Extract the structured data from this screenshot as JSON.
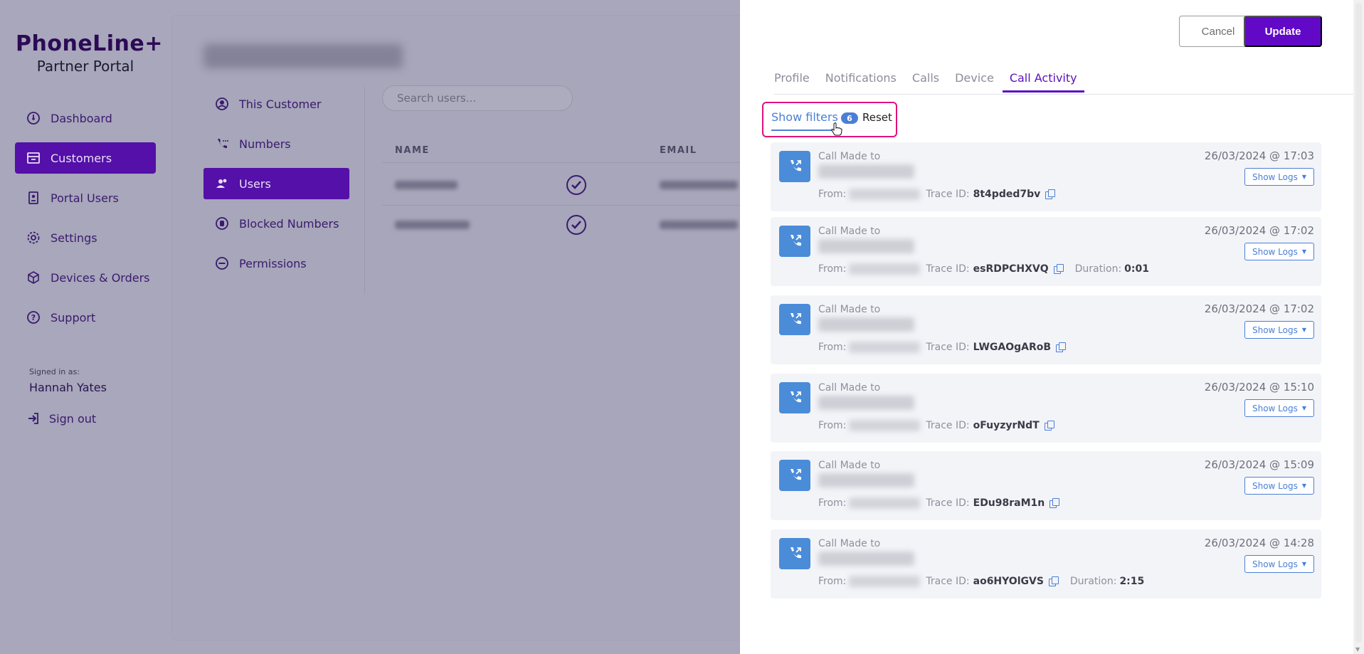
{
  "brand": {
    "name": "PhoneLine+",
    "subtitle": "Partner Portal"
  },
  "sidebar": {
    "items": [
      {
        "label": "Dashboard",
        "icon": "dashboard-icon"
      },
      {
        "label": "Customers",
        "icon": "store-icon",
        "active": true
      },
      {
        "label": "Portal Users",
        "icon": "badge-icon"
      },
      {
        "label": "Settings",
        "icon": "gear-icon"
      },
      {
        "label": "Devices & Orders",
        "icon": "box-icon"
      },
      {
        "label": "Support",
        "icon": "help-icon"
      }
    ],
    "signed_in_label": "Signed in as:",
    "signed_in_name": "Hannah Yates",
    "sign_out": "Sign out"
  },
  "customer_nav": {
    "items": [
      {
        "label": "This Customer",
        "icon": "user-circle-icon"
      },
      {
        "label": "Numbers",
        "icon": "phone-icon"
      },
      {
        "label": "Users",
        "icon": "users-icon",
        "active": true
      },
      {
        "label": "Blocked Numbers",
        "icon": "hand-icon"
      },
      {
        "label": "Permissions",
        "icon": "minus-circle-icon"
      }
    ]
  },
  "users_panel": {
    "search_placeholder": "Search users...",
    "columns": [
      "NAME",
      "EMAIL"
    ]
  },
  "drawer": {
    "cancel_label": "Cancel",
    "update_label": "Update",
    "tabs": [
      "Profile",
      "Notifications",
      "Calls",
      "Device",
      "Call Activity"
    ],
    "active_tab": "Call Activity",
    "filters": {
      "show_label": "Show filters",
      "count": "6",
      "reset_label": "Reset"
    },
    "call_made_label": "Call Made to",
    "from_label": "From:",
    "trace_label": "Trace ID:",
    "duration_label": "Duration:",
    "show_logs_label": "Show Logs",
    "calls": [
      {
        "datetime": "26/03/2024 @ 17:03",
        "trace_id": "8t4pded7bv",
        "duration": ""
      },
      {
        "datetime": "26/03/2024 @ 17:02",
        "trace_id": "esRDPCHXVQ",
        "duration": "0:01"
      },
      {
        "datetime": "26/03/2024 @ 17:02",
        "trace_id": "LWGAOgARoB",
        "duration": ""
      },
      {
        "datetime": "26/03/2024 @ 15:10",
        "trace_id": "oFuyzyrNdT",
        "duration": ""
      },
      {
        "datetime": "26/03/2024 @ 15:09",
        "trace_id": "EDu98raM1n",
        "duration": ""
      },
      {
        "datetime": "26/03/2024 @ 14:28",
        "trace_id": "ao6HYOlGVS",
        "duration": "2:15"
      }
    ]
  }
}
